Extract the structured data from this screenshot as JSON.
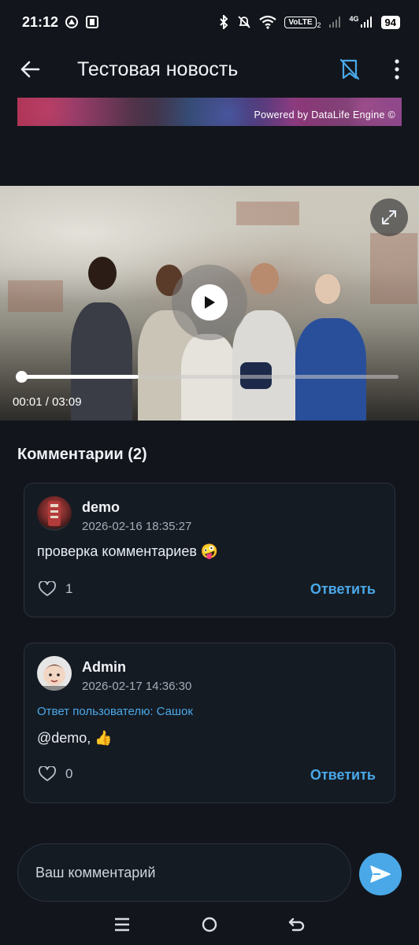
{
  "status_bar": {
    "time": "21:12",
    "volte_label": "VoLTE",
    "volte_sub": "2",
    "network_label": "4G",
    "battery_level": "94"
  },
  "app_bar": {
    "title": "Тестовая новость",
    "icons": [
      "arrow-left-icon",
      "bookmark-off-icon",
      "more-vert-icon"
    ]
  },
  "banner": {
    "text": "Powered by DataLife Engine ©"
  },
  "video": {
    "current_time": "00:01",
    "separator": "/",
    "duration": "03:09",
    "progress_fraction": 0.31,
    "icons": [
      "play-icon",
      "fullscreen-icon"
    ]
  },
  "comments": {
    "title": "Комментарии (2)",
    "items": [
      {
        "author": "demo",
        "date": "2026-02-16 18:35:27",
        "text": "проверка комментариев 🤪",
        "likes": "1",
        "reply_label": "Ответить"
      },
      {
        "author": "Admin",
        "date": "2026-02-17 14:36:30",
        "reply_to": "Ответ пользователю: Сашок",
        "text": "@demo, 👍",
        "likes": "0",
        "reply_label": "Ответить"
      }
    ]
  },
  "comment_input": {
    "placeholder": "Ваш комментарий"
  },
  "colors": {
    "background": "#12161c",
    "card": "#151b23",
    "accent": "#4aa8e8"
  }
}
